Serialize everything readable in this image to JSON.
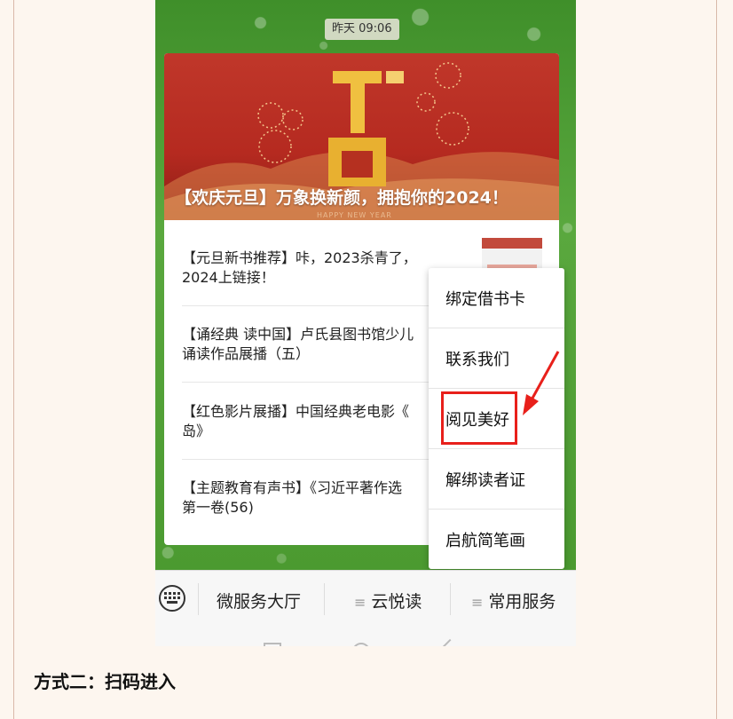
{
  "chat": {
    "timestamp": "昨天 09:06",
    "banner": {
      "title": "【欢庆元旦】万象换新颜，拥抱你的2024！",
      "subtitle": "HAPPY NEW YEAR"
    },
    "articles": [
      {
        "line1": "【元旦新书推荐】咔，2023杀青了，",
        "line2": "2024上链接！"
      },
      {
        "line1": "【诵经典 读中国】卢氏县图书馆少儿",
        "line2": "诵读作品展播（五）"
      },
      {
        "line1": "【红色影片展播】中国经典老电影《",
        "line2": "岛》"
      },
      {
        "line1": "【主题教育有声书】《习近平著作选",
        "line2": "第一卷(56)"
      }
    ]
  },
  "popup_menu": {
    "items": [
      "绑定借书卡",
      "联系我们",
      "阅见美好",
      "解绑读者证",
      "启航简笔画"
    ],
    "highlighted": "阅见美好"
  },
  "bottom_menu": {
    "tabs": [
      "微服务大厅",
      "云悦读",
      "常用服务"
    ]
  },
  "caption": "方式二：扫码进入",
  "colors": {
    "highlight": "#e8201b",
    "banner_red": "#b52a20",
    "background": "#4a9a34"
  }
}
